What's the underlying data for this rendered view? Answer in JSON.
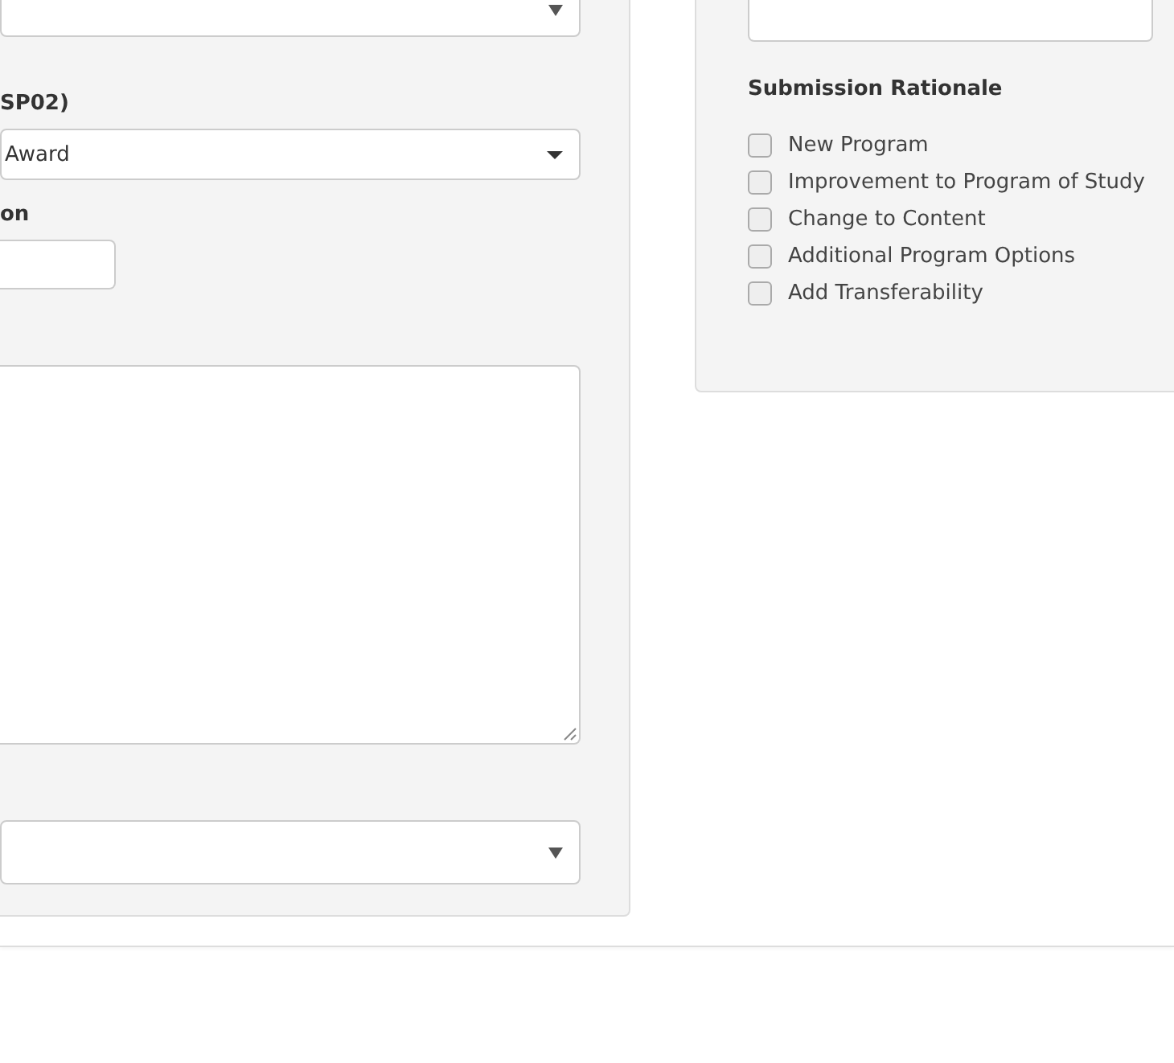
{
  "left_panel": {
    "fields": [
      {
        "kind": "select"
      },
      {
        "kind": "dropdown",
        "label": "SP02)",
        "value": "Award"
      },
      {
        "kind": "input",
        "label": "on"
      },
      {
        "kind": "textarea"
      },
      {
        "kind": "select"
      }
    ]
  },
  "right_panel": {
    "fields": [
      {
        "kind": "textarea"
      }
    ],
    "heading": "Submission Rationale",
    "options": [
      {
        "label": "New Program",
        "checked": false
      },
      {
        "label": "Improvement to Program of Study",
        "checked": false
      },
      {
        "label": "Change to Content",
        "checked": false
      },
      {
        "label": "Additional Program Options",
        "checked": false
      },
      {
        "label": "Add Transferability",
        "checked": false
      }
    ]
  }
}
